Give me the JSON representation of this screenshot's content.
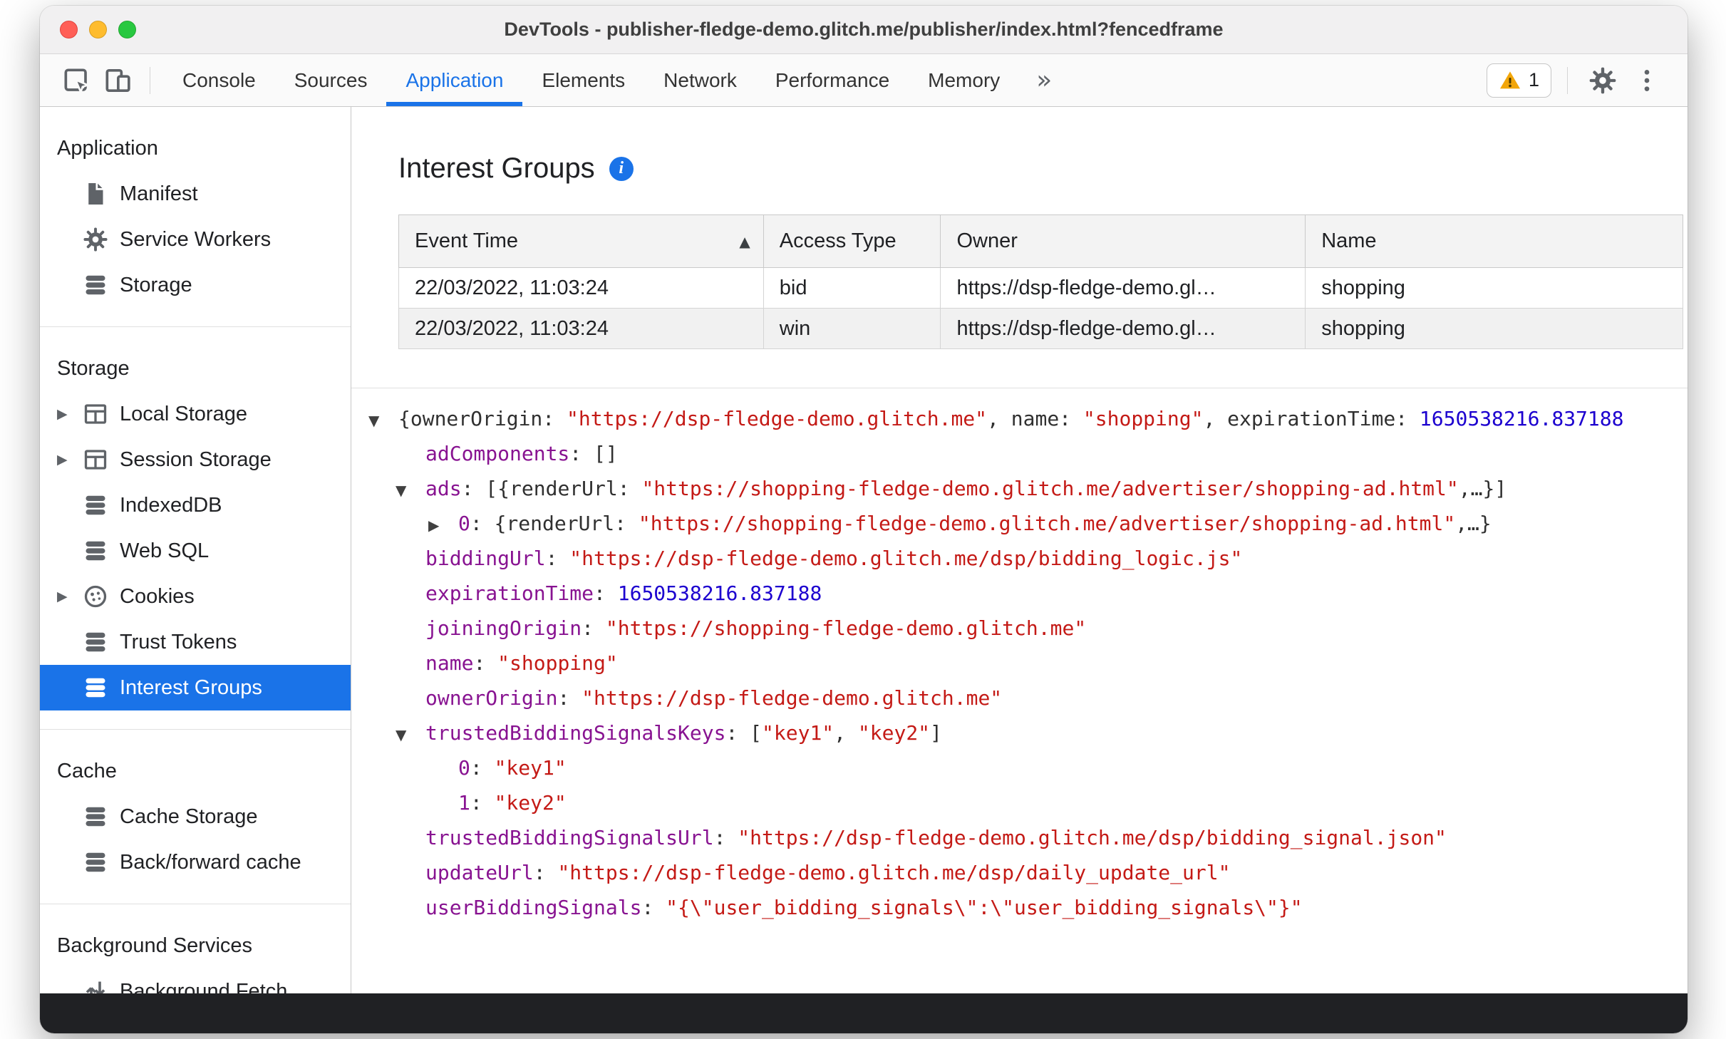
{
  "window": {
    "title": "DevTools - publisher-fledge-demo.glitch.me/publisher/index.html?fencedframe"
  },
  "toolbar": {
    "tabs": [
      {
        "label": "Console",
        "active": false
      },
      {
        "label": "Sources",
        "active": false
      },
      {
        "label": "Application",
        "active": true
      },
      {
        "label": "Elements",
        "active": false
      },
      {
        "label": "Network",
        "active": false
      },
      {
        "label": "Performance",
        "active": false
      },
      {
        "label": "Memory",
        "active": false
      }
    ],
    "more_label": "»",
    "warning_count": "1",
    "icons": [
      "inspect-icon",
      "device-toolbar-icon",
      "warning-triangle-icon",
      "gear-icon",
      "more-vertical-icon"
    ]
  },
  "sidebar": {
    "sections": [
      {
        "title": "Application",
        "items": [
          {
            "label": "Manifest",
            "icon": "document-icon",
            "expandable": false,
            "selected": false
          },
          {
            "label": "Service Workers",
            "icon": "gear-icon",
            "expandable": false,
            "selected": false
          },
          {
            "label": "Storage",
            "icon": "database-icon",
            "expandable": false,
            "selected": false
          }
        ]
      },
      {
        "title": "Storage",
        "items": [
          {
            "label": "Local Storage",
            "icon": "table-icon",
            "expandable": true,
            "selected": false
          },
          {
            "label": "Session Storage",
            "icon": "table-icon",
            "expandable": true,
            "selected": false
          },
          {
            "label": "IndexedDB",
            "icon": "database-icon",
            "expandable": false,
            "selected": false
          },
          {
            "label": "Web SQL",
            "icon": "database-icon",
            "expandable": false,
            "selected": false
          },
          {
            "label": "Cookies",
            "icon": "cookie-icon",
            "expandable": true,
            "selected": false
          },
          {
            "label": "Trust Tokens",
            "icon": "database-icon",
            "expandable": false,
            "selected": false
          },
          {
            "label": "Interest Groups",
            "icon": "database-icon",
            "expandable": false,
            "selected": true
          }
        ]
      },
      {
        "title": "Cache",
        "items": [
          {
            "label": "Cache Storage",
            "icon": "database-icon",
            "expandable": false,
            "selected": false
          },
          {
            "label": "Back/forward cache",
            "icon": "database-icon",
            "expandable": false,
            "selected": false
          }
        ]
      },
      {
        "title": "Background Services",
        "items": [
          {
            "label": "Background Fetch",
            "icon": "sync-arrows-icon",
            "expandable": false,
            "selected": false
          }
        ]
      }
    ]
  },
  "main": {
    "title": "Interest Groups",
    "table": {
      "columns": [
        "Event Time",
        "Access Type",
        "Owner",
        "Name"
      ],
      "sorted_column_index": 0,
      "sort_direction": "asc",
      "rows": [
        [
          "22/03/2022, 11:03:24",
          "bid",
          "https://dsp-fledge-demo.gl…",
          "shopping"
        ],
        [
          "22/03/2022, 11:03:24",
          "win",
          "https://dsp-fledge-demo.gl…",
          "shopping"
        ]
      ]
    },
    "tree": [
      {
        "indent": 0,
        "arrow": "open",
        "tokens": [
          {
            "c": "plain",
            "t": "{ownerOrigin: "
          },
          {
            "c": "string",
            "t": "\"https://dsp-fledge-demo.glitch.me\""
          },
          {
            "c": "plain",
            "t": ", name: "
          },
          {
            "c": "string",
            "t": "\"shopping\""
          },
          {
            "c": "plain",
            "t": ", expirationTime: "
          },
          {
            "c": "number",
            "t": "1650538216.837188"
          }
        ]
      },
      {
        "indent": 1,
        "arrow": "none",
        "tokens": [
          {
            "c": "key",
            "t": "adComponents"
          },
          {
            "c": "plain",
            "t": ": []"
          }
        ]
      },
      {
        "indent": 1,
        "arrow": "open",
        "tokens": [
          {
            "c": "key",
            "t": "ads"
          },
          {
            "c": "plain",
            "t": ": [{renderUrl: "
          },
          {
            "c": "string",
            "t": "\"https://shopping-fledge-demo.glitch.me/advertiser/shopping-ad.html\""
          },
          {
            "c": "plain",
            "t": ",…}]"
          }
        ]
      },
      {
        "indent": 2,
        "arrow": "closed",
        "tokens": [
          {
            "c": "key",
            "t": "0"
          },
          {
            "c": "plain",
            "t": ": {renderUrl: "
          },
          {
            "c": "string",
            "t": "\"https://shopping-fledge-demo.glitch.me/advertiser/shopping-ad.html\""
          },
          {
            "c": "plain",
            "t": ",…}"
          }
        ]
      },
      {
        "indent": 1,
        "arrow": "none",
        "tokens": [
          {
            "c": "key",
            "t": "biddingUrl"
          },
          {
            "c": "plain",
            "t": ": "
          },
          {
            "c": "string",
            "t": "\"https://dsp-fledge-demo.glitch.me/dsp/bidding_logic.js\""
          }
        ]
      },
      {
        "indent": 1,
        "arrow": "none",
        "tokens": [
          {
            "c": "key",
            "t": "expirationTime"
          },
          {
            "c": "plain",
            "t": ": "
          },
          {
            "c": "number",
            "t": "1650538216.837188"
          }
        ]
      },
      {
        "indent": 1,
        "arrow": "none",
        "tokens": [
          {
            "c": "key",
            "t": "joiningOrigin"
          },
          {
            "c": "plain",
            "t": ": "
          },
          {
            "c": "string",
            "t": "\"https://shopping-fledge-demo.glitch.me\""
          }
        ]
      },
      {
        "indent": 1,
        "arrow": "none",
        "tokens": [
          {
            "c": "key",
            "t": "name"
          },
          {
            "c": "plain",
            "t": ": "
          },
          {
            "c": "string",
            "t": "\"shopping\""
          }
        ]
      },
      {
        "indent": 1,
        "arrow": "none",
        "tokens": [
          {
            "c": "key",
            "t": "ownerOrigin"
          },
          {
            "c": "plain",
            "t": ": "
          },
          {
            "c": "string",
            "t": "\"https://dsp-fledge-demo.glitch.me\""
          }
        ]
      },
      {
        "indent": 1,
        "arrow": "open",
        "tokens": [
          {
            "c": "key",
            "t": "trustedBiddingSignalsKeys"
          },
          {
            "c": "plain",
            "t": ": ["
          },
          {
            "c": "string",
            "t": "\"key1\""
          },
          {
            "c": "plain",
            "t": ", "
          },
          {
            "c": "string",
            "t": "\"key2\""
          },
          {
            "c": "plain",
            "t": "]"
          }
        ]
      },
      {
        "indent": 2,
        "arrow": "none",
        "tokens": [
          {
            "c": "key",
            "t": "0"
          },
          {
            "c": "plain",
            "t": ": "
          },
          {
            "c": "string",
            "t": "\"key1\""
          }
        ]
      },
      {
        "indent": 2,
        "arrow": "none",
        "tokens": [
          {
            "c": "key",
            "t": "1"
          },
          {
            "c": "plain",
            "t": ": "
          },
          {
            "c": "string",
            "t": "\"key2\""
          }
        ]
      },
      {
        "indent": 1,
        "arrow": "none",
        "tokens": [
          {
            "c": "key",
            "t": "trustedBiddingSignalsUrl"
          },
          {
            "c": "plain",
            "t": ": "
          },
          {
            "c": "string",
            "t": "\"https://dsp-fledge-demo.glitch.me/dsp/bidding_signal.json\""
          }
        ]
      },
      {
        "indent": 1,
        "arrow": "none",
        "tokens": [
          {
            "c": "key",
            "t": "updateUrl"
          },
          {
            "c": "plain",
            "t": ": "
          },
          {
            "c": "string",
            "t": "\"https://dsp-fledge-demo.glitch.me/dsp/daily_update_url\""
          }
        ]
      },
      {
        "indent": 1,
        "arrow": "none",
        "tokens": [
          {
            "c": "key",
            "t": "userBiddingSignals"
          },
          {
            "c": "plain",
            "t": ": "
          },
          {
            "c": "string",
            "t": "\"{\\\"user_bidding_signals\\\":\\\"user_bidding_signals\\\"}\""
          }
        ]
      }
    ]
  },
  "colors": {
    "accent": "#1a73e8",
    "selected_row_bg": "#1a73e8",
    "json_key": "#881391",
    "json_string": "#c41a16",
    "json_number": "#1c00cf",
    "warning": "#f2a60a",
    "traffic_close": "#ff5f57",
    "traffic_minimize": "#febc2e",
    "traffic_zoom": "#28c840"
  }
}
